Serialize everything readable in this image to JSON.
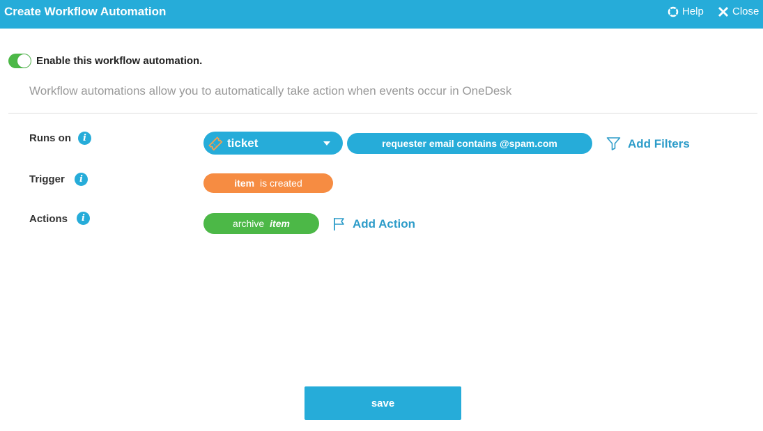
{
  "header": {
    "title": "Create Workflow Automation",
    "help_label": "Help",
    "close_label": "Close"
  },
  "enable": {
    "label": "Enable this workflow automation.",
    "enabled": true
  },
  "description": "Workflow automations allow you to automatically take action when events occur in OneDesk",
  "rows": {
    "runs_on": {
      "label": "Runs on",
      "item_type": "ticket",
      "filter": "requester email contains @spam.com",
      "add_filters_label": "Add Filters"
    },
    "trigger": {
      "label": "Trigger",
      "subject": "item",
      "event": "is created"
    },
    "actions": {
      "label": "Actions",
      "verb": "archive",
      "object": "item",
      "add_action_label": "Add Action"
    }
  },
  "info_glyph": "i",
  "save_label": "save",
  "colors": {
    "header": "#26acd9",
    "toggle_on": "#4cb847",
    "trigger_pill": "#f68c42",
    "action_pill": "#4cb847",
    "link": "#2d9cc9"
  },
  "icons": {
    "help": "lifebuoy-icon",
    "close": "close-icon",
    "ticket": "ticket-icon",
    "filter": "funnel-icon",
    "action": "flag-icon",
    "info": "info-icon"
  }
}
